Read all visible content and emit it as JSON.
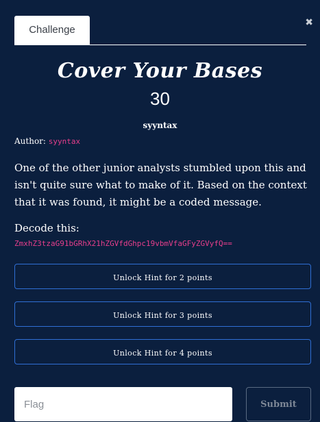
{
  "tabs": [
    {
      "label": "Challenge"
    }
  ],
  "close_icon": "close-icon",
  "challenge": {
    "title": "Cover Your Bases",
    "points": "30",
    "author_name": "syyntax",
    "author_label": "Author:",
    "author_link": "syyntax",
    "description": "One of the other junior analysts stumbled upon this and isn't quite sure what to make of it. Based on the context that it was found, it might be a coded message.",
    "decode_label": "Decode this:",
    "encoded": "ZmxhZ3tzaG91bGRhX21hZGVfdGhpc19vbmVfaGFyZGVyfQ=="
  },
  "hints": [
    {
      "label": "Unlock Hint for 2 points"
    },
    {
      "label": "Unlock Hint for 3 points"
    },
    {
      "label": "Unlock Hint for 4 points"
    }
  ],
  "form": {
    "flag_placeholder": "Flag",
    "submit_label": "Submit"
  },
  "colors": {
    "background": "#0b1f3e",
    "accent_pink": "#e83e8c",
    "button_border": "#2f6fd6"
  }
}
